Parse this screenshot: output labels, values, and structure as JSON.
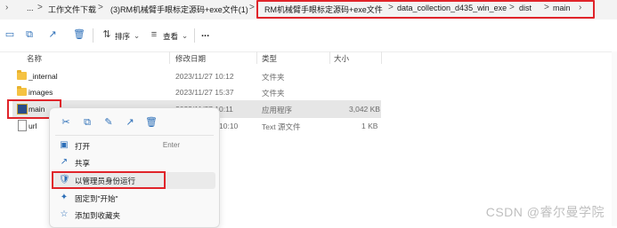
{
  "breadcrumb": {
    "items": [
      "...",
      "工作文件下载",
      "(3)RM机械臂手眼标定源码+exe文件(1)",
      "RM机械臂手眼标定源码+exe文件",
      "data_collection_d435_win_exe",
      "dist",
      "main"
    ],
    "separator": ">"
  },
  "toolbar": {
    "sort_label": "排序",
    "view_label": "查看",
    "more_label": "..."
  },
  "columns": {
    "name": "名称",
    "modified": "修改日期",
    "type": "类型",
    "size": "大小"
  },
  "files": [
    {
      "name": "_internal",
      "modified": "2023/11/27 10:12",
      "type": "文件夹",
      "size": "",
      "icon": "folder-icon"
    },
    {
      "name": "images",
      "modified": "2023/11/27 15:37",
      "type": "文件夹",
      "size": "",
      "icon": "folder-icon"
    },
    {
      "name": "main",
      "modified": "2023/11/27 10:11",
      "type": "应用程序",
      "size": "3,042 KB",
      "icon": "exe-icon"
    },
    {
      "name": "url",
      "modified": "10:10",
      "type": "Text 源文件",
      "size": "1 KB",
      "icon": "text-file-icon"
    }
  ],
  "context_menu": {
    "items": [
      {
        "label": "打开",
        "shortcut": "Enter",
        "icon": "open-icon"
      },
      {
        "label": "共享",
        "shortcut": "",
        "icon": "share-icon"
      },
      {
        "label": "以管理员身份运行",
        "shortcut": "",
        "icon": "shield-icon"
      },
      {
        "label": "固定到\"开始\"",
        "shortcut": "",
        "icon": "pin-icon"
      },
      {
        "label": "添加到收藏夹",
        "shortcut": "",
        "icon": "star-icon"
      }
    ]
  },
  "watermark": "CSDN @睿尔曼学院",
  "colors": {
    "highlight_red": "#e0242a",
    "accent_blue": "#2d6fb8",
    "folder_yellow": "#f5c242"
  }
}
